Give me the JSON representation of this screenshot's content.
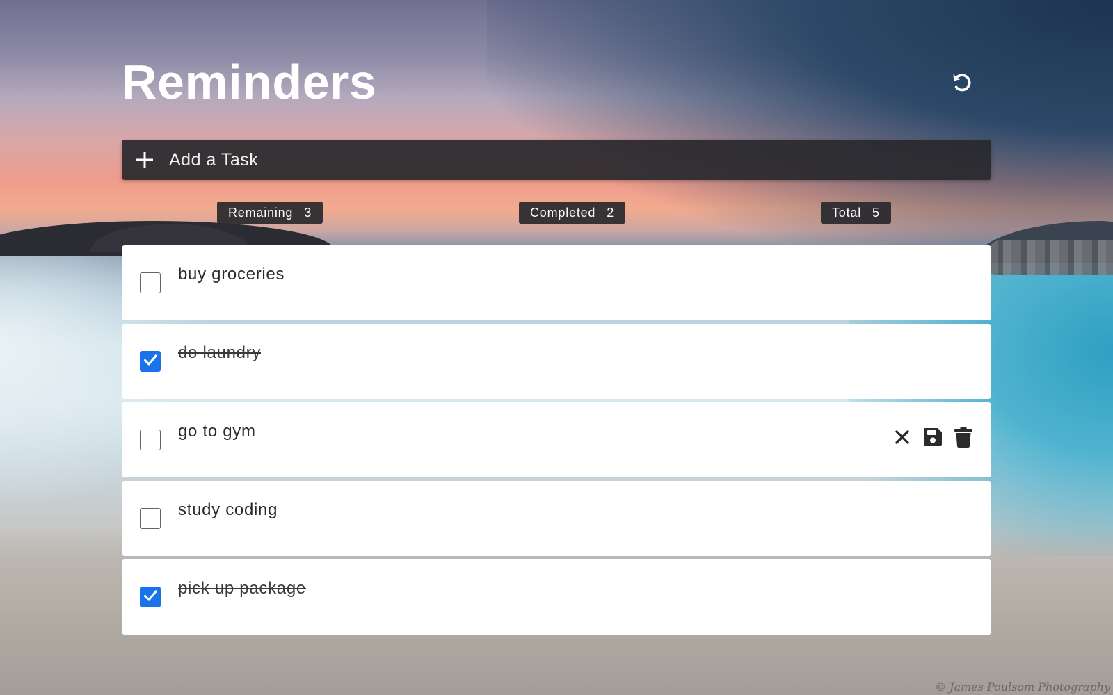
{
  "app": {
    "title": "Reminders",
    "reset_icon": "undo-icon"
  },
  "add_task": {
    "icon": "plus-icon",
    "label": "Add a Task"
  },
  "stats": {
    "remaining": {
      "label": "Remaining",
      "count": "3"
    },
    "completed": {
      "label": "Completed",
      "count": "2"
    },
    "total": {
      "label": "Total",
      "count": "5"
    }
  },
  "tasks": [
    {
      "text": "buy groceries",
      "done": false
    },
    {
      "text": "do laundry",
      "done": true
    },
    {
      "text": "go to gym",
      "done": false,
      "actions": [
        "close-icon",
        "save-icon",
        "trash-icon"
      ]
    },
    {
      "text": "study coding",
      "done": false
    },
    {
      "text": "pick up package",
      "done": true
    }
  ],
  "colors": {
    "accent": "#1a73e8",
    "bar": "#28282c",
    "card": "#ffffff"
  },
  "watermark": "© James Poulsom Photography"
}
